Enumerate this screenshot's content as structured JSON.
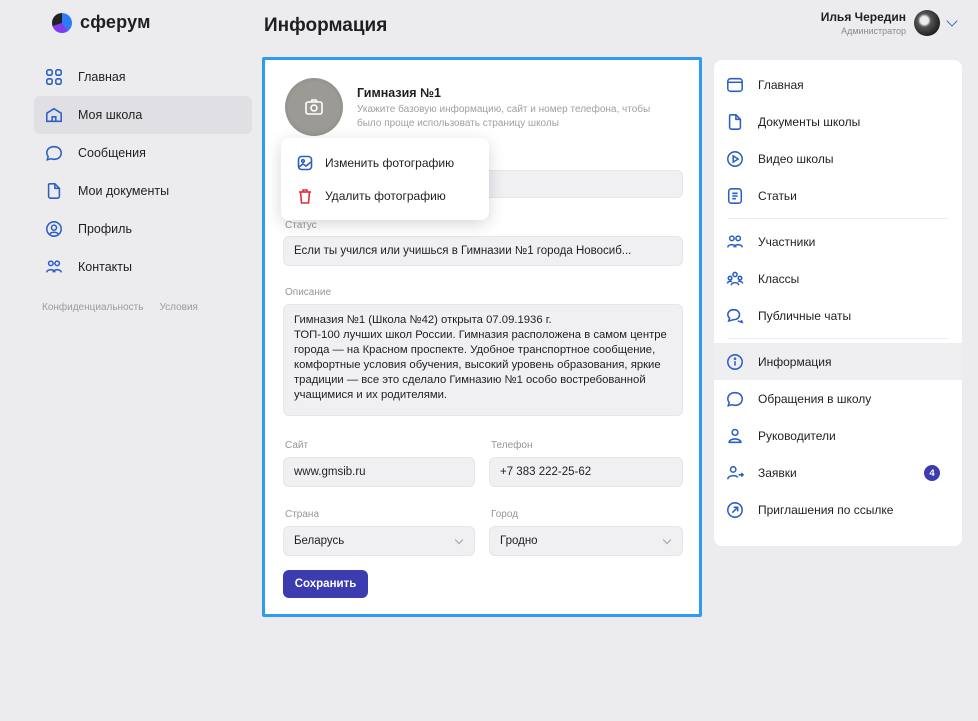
{
  "brand": {
    "name": "сферум"
  },
  "header": {
    "title": "Информация"
  },
  "user": {
    "name": "Илья Чередин",
    "role": "Администратор"
  },
  "leftnav": {
    "items": [
      {
        "label": "Главная",
        "icon": "grid-icon"
      },
      {
        "label": "Моя школа",
        "icon": "school-icon",
        "active": true
      },
      {
        "label": "Сообщения",
        "icon": "chat-icon"
      },
      {
        "label": "Мои документы",
        "icon": "document-icon"
      },
      {
        "label": "Профиль",
        "icon": "profile-icon"
      },
      {
        "label": "Контакты",
        "icon": "contacts-icon"
      }
    ],
    "footer": {
      "privacy": "Конфиденциальность",
      "terms": "Условия"
    }
  },
  "school": {
    "name": "Гимназия №1",
    "description": "Укажите базовую информацию, сайт и номер телефона, чтобы было проще использовать страницу школы"
  },
  "photo_menu": {
    "change": "Изменить фотографию",
    "delete": "Удалить фотографию"
  },
  "form": {
    "status_label": "Статус",
    "status_value": "Если ты учился или учишься в Гимназии №1 города Новосиб...",
    "description_label": "Описание",
    "description_value": "Гимназия №1 (Школа №42) открыта 07.09.1936 г.\nТОП-100 лучших школ России. Гимназия расположена в самом центре города — на Красном проспекте. Удобное транспортное сообщение, комфортные условия обучения, высокий уровень образования, яркие традиции — все это сделало Гимназию №1 особо востребованной учащимися и их родителями.",
    "site_label": "Сайт",
    "site_value": "www.gmsib.ru",
    "phone_label": "Телефон",
    "phone_value": "+7 383 222-25-62",
    "country_label": "Страна",
    "country_value": "Беларусь",
    "city_label": "Город",
    "city_value": "Гродно",
    "save_label": "Сохранить"
  },
  "rightnav": {
    "group1": [
      {
        "label": "Главная",
        "icon": "window-icon"
      },
      {
        "label": "Документы школы",
        "icon": "document-icon"
      },
      {
        "label": "Видео школы",
        "icon": "play-icon"
      },
      {
        "label": "Статьи",
        "icon": "article-icon"
      }
    ],
    "group2": [
      {
        "label": "Участники",
        "icon": "users-icon"
      },
      {
        "label": "Классы",
        "icon": "classes-icon"
      },
      {
        "label": "Публичные чаты",
        "icon": "chats-icon"
      }
    ],
    "group3": [
      {
        "label": "Информация",
        "icon": "info-icon",
        "active": true
      },
      {
        "label": "Обращения в школу",
        "icon": "chat-icon"
      },
      {
        "label": "Руководители",
        "icon": "person-icon"
      },
      {
        "label": "Заявки",
        "icon": "add-person-icon",
        "badge": "4"
      },
      {
        "label": "Приглашения по ссылке",
        "icon": "link-arrow-icon"
      }
    ]
  },
  "colors": {
    "accent": "#2c5fc4",
    "button": "#3c3bb0",
    "highlight_border": "#2d9cf0",
    "delete": "#e0303a"
  }
}
